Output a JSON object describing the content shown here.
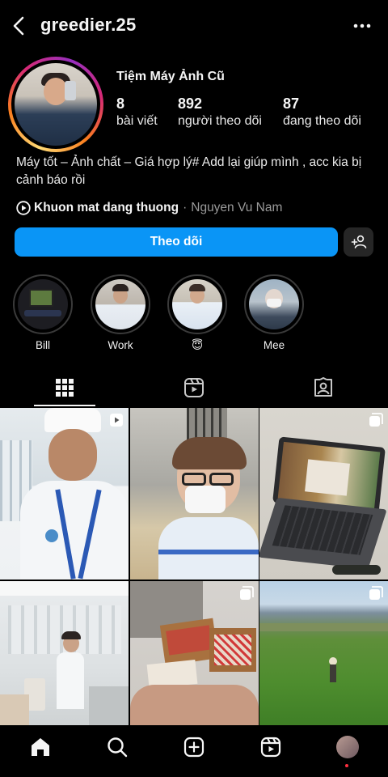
{
  "header": {
    "username": "greedier.25"
  },
  "profile": {
    "display_name": "Tiệm Máy Ảnh Cũ",
    "stats": [
      {
        "value": "8",
        "label": "bài viết"
      },
      {
        "value": "892",
        "label": "người theo dõi"
      },
      {
        "value": "87",
        "label": "đang theo dõi"
      }
    ],
    "bio": "Máy tốt – Ảnh chất – Giá hợp lý# Add lại giúp mình , acc kia bị cảnh báo rồi",
    "music": {
      "song": "Khuon mat dang thuong",
      "separator": "·",
      "artist": "Nguyen Vu Nam"
    }
  },
  "actions": {
    "follow_label": "Theo dõi"
  },
  "highlights": [
    {
      "label": "Bill"
    },
    {
      "label": "Work"
    },
    {
      "label": "😇"
    },
    {
      "label": "Mee"
    }
  ],
  "colors": {
    "accent": "#0A95F6",
    "background": "#000000",
    "secondary_button": "#262626",
    "notification_dot": "#FF3040"
  },
  "icons": [
    "back-icon",
    "more-icon",
    "play-icon",
    "add-person-icon",
    "grid-icon",
    "reels-icon",
    "tagged-icon",
    "home-icon",
    "search-icon",
    "create-icon"
  ]
}
